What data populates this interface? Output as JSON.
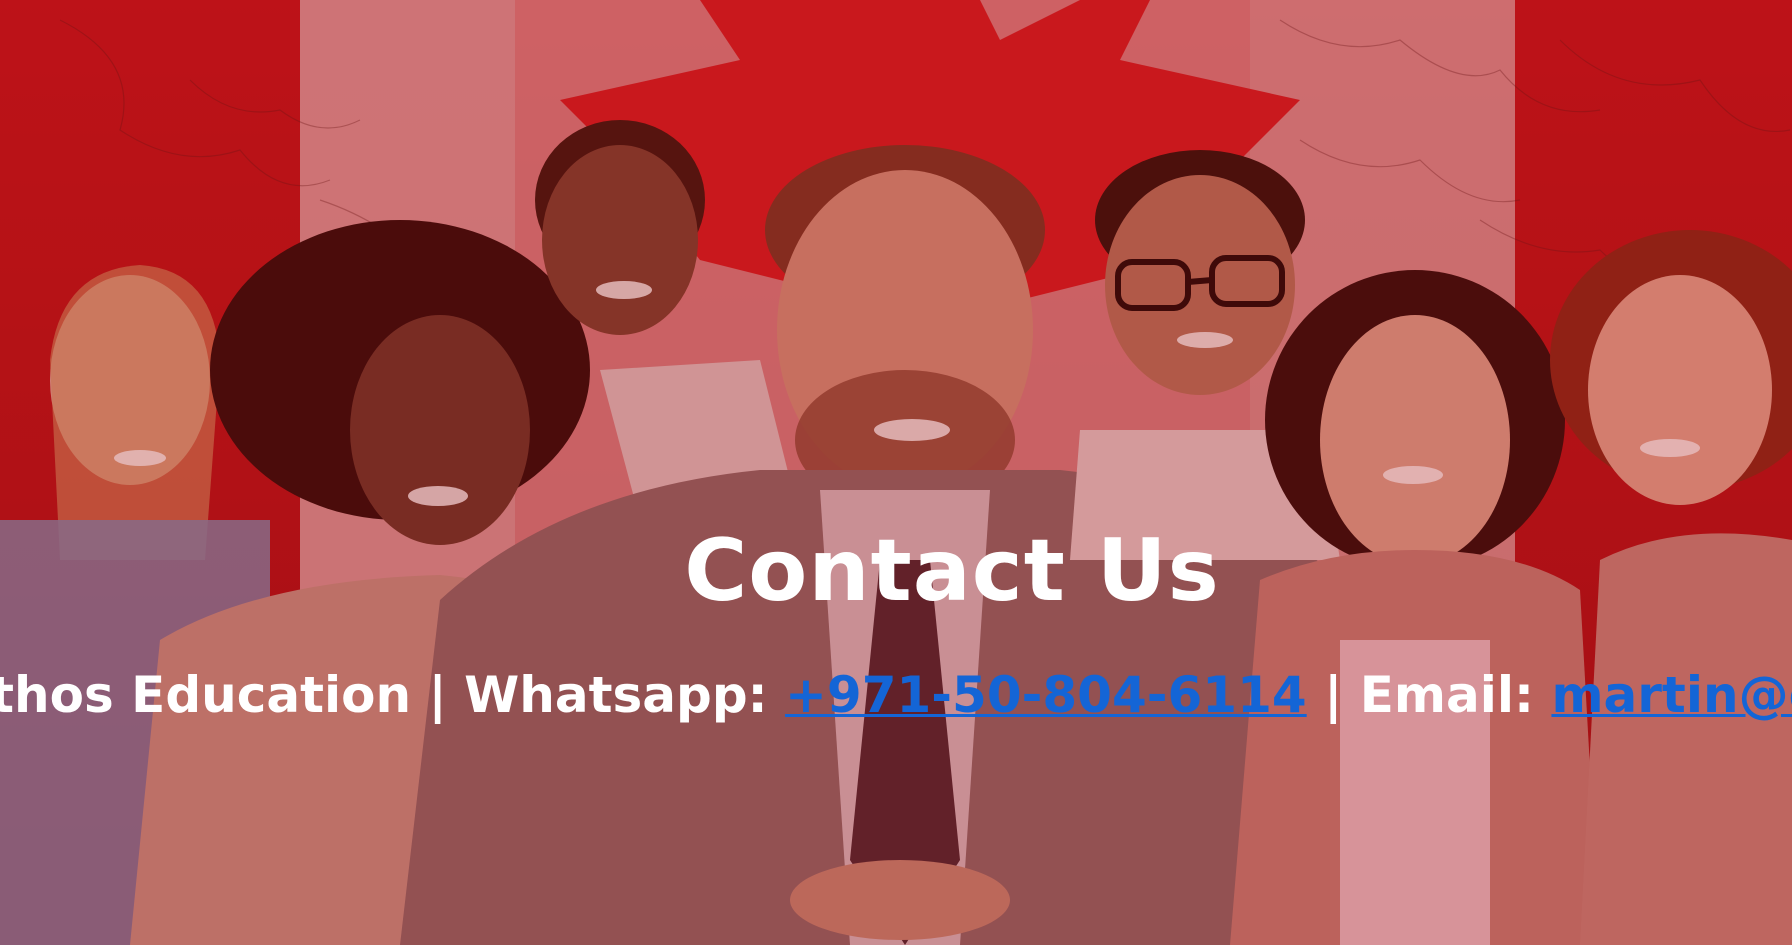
{
  "hero": {
    "title": "Contact Us",
    "company_text": "Ethos Education",
    "separator": " | ",
    "whatsapp_label": "Whatsapp: ",
    "whatsapp_number": "+971-50-804-6114",
    "email_label": "Email: ",
    "email_address": "martin@ethoseducation.com"
  },
  "background": {
    "description_icon": "canada-flag-students-photo",
    "accent_color": "#d6151c",
    "link_color": "#1465d6",
    "text_color": "#ffffff"
  }
}
